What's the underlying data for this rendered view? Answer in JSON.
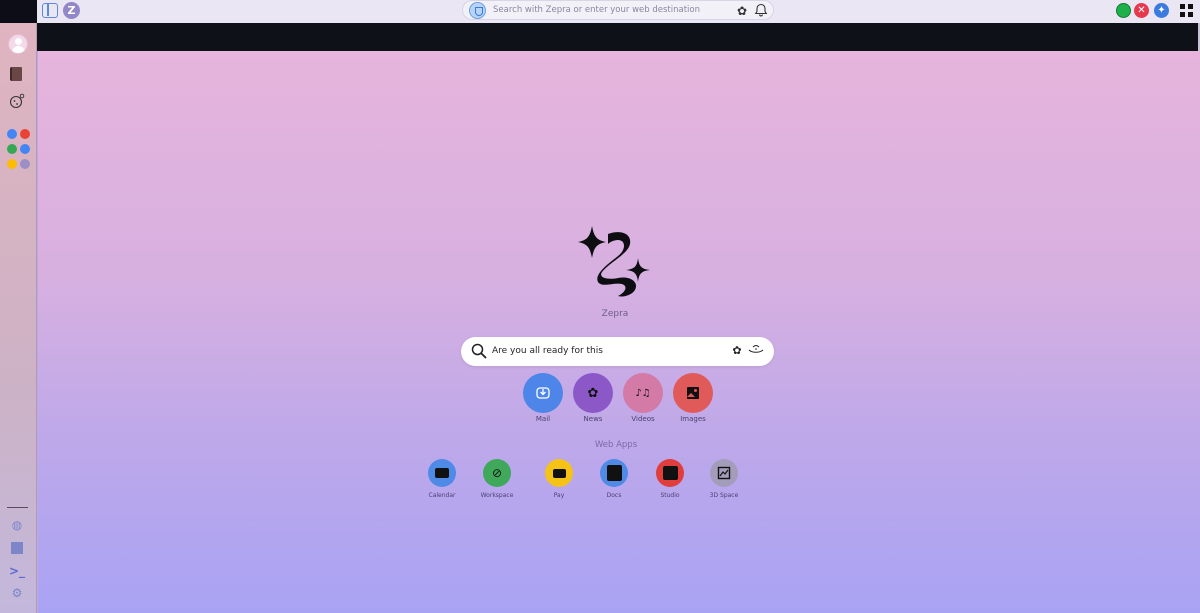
{
  "topbar": {
    "url_placeholder": "Search with Zepra or enter your web destination",
    "icons": [
      "sidebar-toggle-icon",
      "zepra-logo-icon",
      "shield-icon",
      "extensions-icon",
      "bell-icon",
      "green-status-icon",
      "close-icon",
      "add-icon",
      "grid-menu-icon"
    ]
  },
  "sidebar": {
    "icons": [
      "profile-avatar",
      "book-icon",
      "cookie-icon",
      "apps-dots",
      "globe-icon",
      "square-icon",
      "terminal-icon",
      "user-settings-icon"
    ],
    "dot_colors": [
      "#4285f4",
      "#ea4335",
      "#34a853",
      "#4285f4",
      "#fbbc05",
      "#9b8fc4"
    ]
  },
  "main": {
    "brand": "Zepra",
    "search": {
      "value": "Are you all ready for this",
      "icons": [
        "search-icon",
        "extensions-icon",
        "voice-icon"
      ]
    },
    "quick_links": [
      {
        "label": "Mail",
        "icon": "inbox-icon",
        "color": "#4d86e8"
      },
      {
        "label": "News",
        "icon": "news-icon",
        "color": "#8c58c8"
      },
      {
        "label": "Videos",
        "icon": "videos-icon",
        "color": "#d47aa6"
      },
      {
        "label": "Images",
        "icon": "image-icon",
        "color": "#e05a5a"
      }
    ],
    "web_apps_title": "Web Apps",
    "web_apps": [
      {
        "label": "Calendar",
        "icon": "calendar-icon",
        "color": "#4e8ae6"
      },
      {
        "label": "Workspace",
        "icon": "workspace-icon",
        "color": "#3fa85a"
      },
      {
        "label": "Pay",
        "icon": "pay-icon",
        "color": "#f5c218"
      },
      {
        "label": "Docs",
        "icon": "docs-icon",
        "color": "#4e8ae6"
      },
      {
        "label": "Studio",
        "icon": "studio-icon",
        "color": "#e03d3d"
      },
      {
        "label": "3D Space",
        "icon": "3d-space-icon",
        "color": "#a39dbb"
      }
    ]
  },
  "colors": {
    "accent_green": "#1fb04c",
    "accent_red": "#e53950",
    "accent_blue": "#3a7be0"
  }
}
